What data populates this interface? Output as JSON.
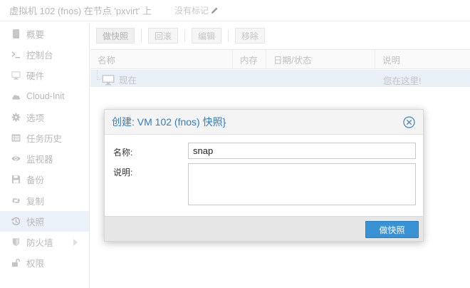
{
  "topbar": {
    "title": "虚拟机 102 (fnos) 在节点 'pxvirt' 上",
    "tags": "没有标记"
  },
  "sidebar": {
    "items": [
      {
        "label": "概要",
        "icon": "book-icon"
      },
      {
        "label": "控制台",
        "icon": "terminal-icon"
      },
      {
        "label": "硬件",
        "icon": "monitor-icon"
      },
      {
        "label": "Cloud-Init",
        "icon": "cloud-icon"
      },
      {
        "label": "选项",
        "icon": "gear-icon"
      },
      {
        "label": "任务历史",
        "icon": "list-icon"
      },
      {
        "label": "监视器",
        "icon": "eye-icon"
      },
      {
        "label": "备份",
        "icon": "floppy-icon"
      },
      {
        "label": "复制",
        "icon": "retweet-icon"
      },
      {
        "label": "快照",
        "icon": "history-icon"
      },
      {
        "label": "防火墙",
        "icon": "shield-icon"
      },
      {
        "label": "权限",
        "icon": "unlock-icon"
      }
    ]
  },
  "toolbar": {
    "take_snapshot": "做快照",
    "rollback": "回滚",
    "edit": "编辑",
    "remove": "移除"
  },
  "grid": {
    "columns": [
      "名称",
      "内存",
      "日期/状态",
      "说明"
    ],
    "rows": [
      {
        "name": "现在",
        "description": "您在这里!"
      }
    ]
  },
  "dialog": {
    "title": "创建: VM 102 (fnos) 快照}",
    "name_label": "名称:",
    "name_value": "snap",
    "desc_label": "说明:",
    "ok_label": "做快照"
  }
}
